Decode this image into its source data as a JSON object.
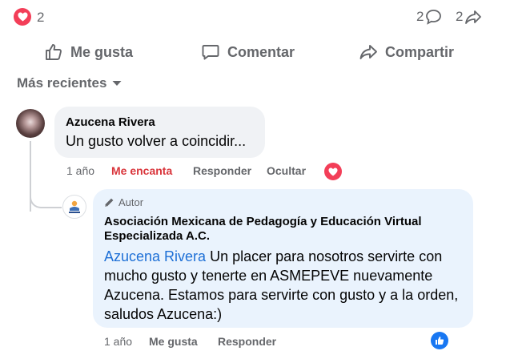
{
  "stats": {
    "reactions_count": "2",
    "comments_count": "2",
    "shares_count": "2"
  },
  "actions": {
    "like": "Me gusta",
    "comment": "Comentar",
    "share": "Compartir"
  },
  "sort": {
    "label": "Más recientes"
  },
  "comments": [
    {
      "author": "Azucena Rivera",
      "text": "Un gusto volver a coincidir...",
      "time": "1 año",
      "reaction_state": "Me encanta",
      "reply": "Responder",
      "hide": "Ocultar",
      "reaction_icon": "love-icon"
    }
  ],
  "reply": {
    "badge": "Autor",
    "author": "Asociación Mexicana de Pedagogía y Educación Virtual Especializada A.C.",
    "mention": "Azucena Rivera",
    "text": " Un placer para nosotros servirte con mucho gusto y tenerte en ASMEPEVE nuevamente Azucena. Estamos para servirte con gusto y a la orden, saludos Azucena:)",
    "time": "1 año",
    "like": "Me gusta",
    "reply": "Responder",
    "reaction_icon": "like-icon"
  },
  "colors": {
    "love": "#f33e58",
    "like": "#1877f2",
    "loved_text": "#d9353b",
    "secondary_text": "#65676b",
    "bubble": "#f0f2f5",
    "author_bubble": "#eaf3fd",
    "mention": "#1d6fd6"
  }
}
